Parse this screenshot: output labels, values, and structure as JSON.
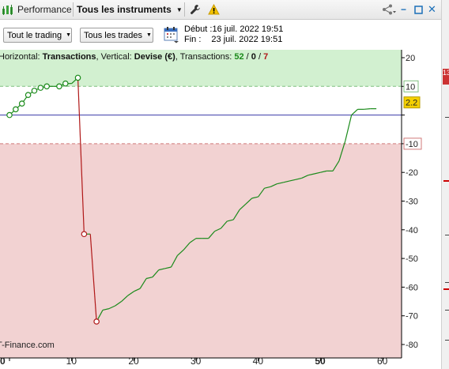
{
  "toolbar": {
    "title": "Performance",
    "instrument_selector": "Tous les instruments",
    "icons": [
      "chart-bars-icon",
      "wrench-icon",
      "warning-icon",
      "share-icon",
      "minimize-icon",
      "maximize-icon",
      "close-icon"
    ]
  },
  "filters": {
    "trading_dropdown": "Tout le trading",
    "trades_dropdown": "Tous les trades",
    "start_label": "Début :",
    "start_value": "16 juil. 2022 19:51",
    "end_label": "Fin :",
    "end_value": "23 juil. 2022 19:51"
  },
  "chart_header": {
    "prefix": "Horizontal: ",
    "horizontal_value": "Transactions",
    "mid": ", Vertical: ",
    "vertical_value": "Devise (€)",
    "tx_label": ", Transactions: ",
    "winners": "52",
    "slash1": " / ",
    "neutral": "0",
    "slash2": " / ",
    "losers": "7"
  },
  "watermark": "T-Finance.com",
  "colors": {
    "profit_zone": "#d2f0d0",
    "loss_zone": "#f2d2d2",
    "winning_line": "#1a8a1a",
    "losing_line": "#b01818",
    "zero_line": "#3a3aa8",
    "current_badge": "#f5d000"
  },
  "right_strip": {
    "label": "13"
  },
  "chart_data": {
    "type": "line",
    "xlabel": "",
    "ylabel": "",
    "xlim": [
      0,
      63
    ],
    "ylim": [
      -82,
      22
    ],
    "x_ticks": [
      "0",
      "10",
      "20",
      "30",
      "40",
      "50",
      "60"
    ],
    "y_ticks": [
      "20",
      "10",
      "0",
      "-10",
      "-20",
      "-30",
      "-40",
      "-50",
      "-60",
      "-70",
      "-80"
    ],
    "thresholds": {
      "upper": 10,
      "lower": -10,
      "upper_label": "10",
      "lower_label": "-10"
    },
    "current_value": "2.2",
    "series": [
      {
        "x": [
          0,
          1,
          2,
          3,
          4,
          5,
          6,
          7,
          8,
          9,
          10,
          11,
          12,
          13,
          14,
          15,
          16,
          17,
          18,
          19,
          20,
          21,
          22,
          23,
          24,
          25,
          26,
          27,
          28,
          29,
          30,
          31,
          32,
          33,
          34,
          35,
          36,
          37,
          38,
          39,
          40,
          41,
          42,
          43,
          44,
          45,
          46,
          47,
          48,
          49,
          50,
          51,
          52,
          53,
          54,
          55,
          56,
          57,
          58,
          59
        ],
        "y": [
          0,
          2,
          4,
          7,
          8.5,
          9.5,
          10,
          10,
          10,
          11,
          11,
          13,
          -41.5,
          -41.5,
          -72,
          -68,
          -67.5,
          -66.5,
          -65,
          -63,
          -61.5,
          -60.5,
          -57,
          -56.5,
          -54,
          -53.5,
          -53,
          -49,
          -47,
          -44.5,
          -43,
          -43,
          -43,
          -40.5,
          -39.5,
          -37,
          -36.5,
          -33,
          -31,
          -29,
          -28.5,
          -25.5,
          -25,
          -24,
          -23.5,
          -23,
          -22.5,
          -22,
          -21,
          -20.5,
          -20,
          -19.5,
          -19.5,
          -16,
          -9,
          0,
          2,
          2,
          2.2,
          2.2
        ]
      }
    ],
    "markers": {
      "win_x": [
        0,
        1,
        2,
        3,
        4,
        5,
        6,
        8,
        9,
        11
      ],
      "loss_x": [
        12,
        14
      ]
    }
  }
}
